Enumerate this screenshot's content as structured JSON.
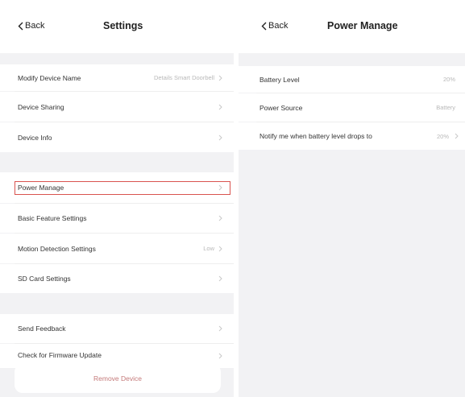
{
  "settings": {
    "back_label": "Back",
    "title": "Settings",
    "rows": [
      {
        "label": "Modify Device Name",
        "value": "Details Smart Doorbell"
      },
      {
        "label": "Device Sharing",
        "value": ""
      },
      {
        "label": "Device Info",
        "value": ""
      },
      {
        "label": "Power Manage",
        "value": ""
      },
      {
        "label": "Basic Feature Settings",
        "value": ""
      },
      {
        "label": "Motion Detection Settings",
        "value": "Low"
      },
      {
        "label": "SD Card Settings",
        "value": ""
      },
      {
        "label": "Send Feedback",
        "value": ""
      },
      {
        "label": "Check for Firmware Update",
        "value": ""
      }
    ],
    "remove_label": "Remove Device"
  },
  "power_manage": {
    "back_label": "Back",
    "title": "Power Manage",
    "rows": [
      {
        "label": "Battery Level",
        "value": "20%"
      },
      {
        "label": "Power Source",
        "value": "Battery"
      },
      {
        "label": "Notify me when battery level drops to",
        "value": "20%"
      }
    ]
  },
  "colors": {
    "highlight": "#d9534f",
    "background": "#f2f2f4",
    "remove_text": "#c47a7a"
  }
}
